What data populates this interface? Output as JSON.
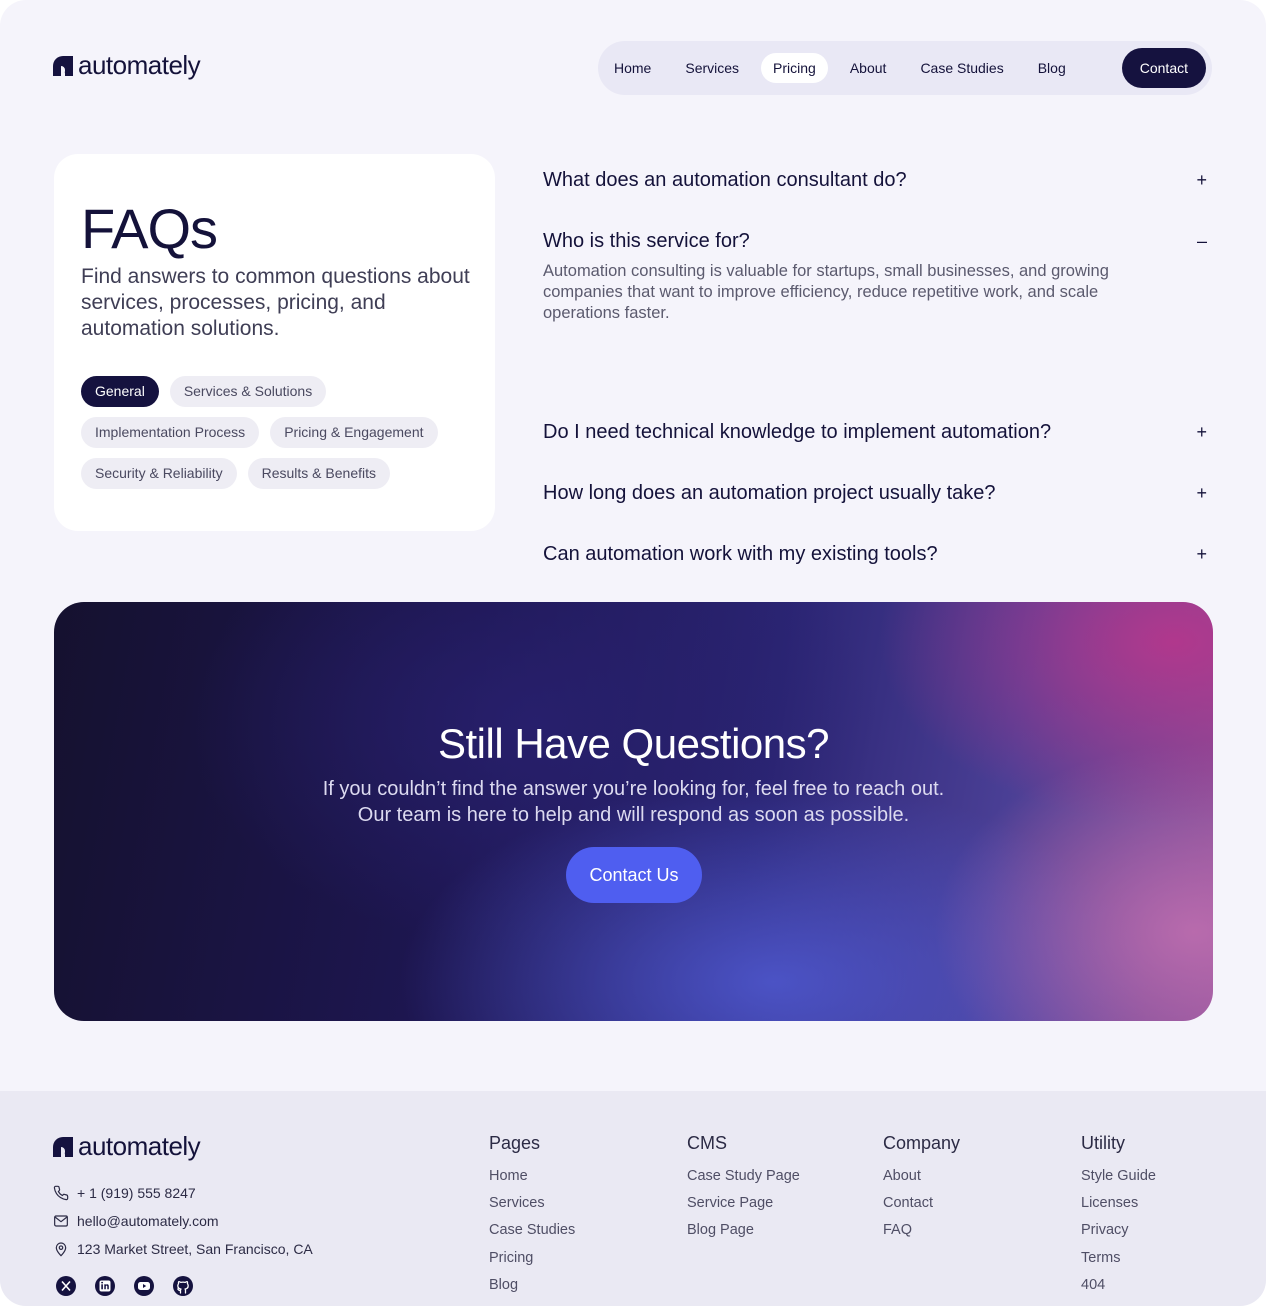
{
  "brand": {
    "name": "automately"
  },
  "nav": {
    "items": [
      "Home",
      "Services",
      "Pricing",
      "About",
      "Case Studies",
      "Blog"
    ],
    "active": "Pricing",
    "cta": "Contact"
  },
  "faq": {
    "title": "FAQs",
    "subtitle": "Find answers to common questions about services, processes, pricing, and automation solutions.",
    "categories": [
      "General",
      "Services & Solutions",
      "Implementation Process",
      "Pricing & Engagement",
      "Security & Reliability",
      "Results & Benefits"
    ],
    "active_category": "General",
    "items": [
      {
        "question": "What does an automation consultant do?",
        "toggle": "+",
        "answer": ""
      },
      {
        "question": "Who is this service for?",
        "toggle": "–",
        "answer": "Automation consulting is valuable for startups, small businesses, and growing companies that want to improve efficiency, reduce repetitive work, and scale operations faster."
      },
      {
        "question": "Do I need technical knowledge to implement automation?",
        "toggle": "+",
        "answer": ""
      },
      {
        "question": "How long does an automation project usually take?",
        "toggle": "+",
        "answer": ""
      },
      {
        "question": "Can automation work with my existing tools?",
        "toggle": "+",
        "answer": ""
      }
    ]
  },
  "cta": {
    "title": "Still Have Questions?",
    "line1": "If you couldn’t find the answer you’re looking for, feel free to reach out.",
    "line2": "Our team is here to help and will respond as soon as possible.",
    "button": "Contact Us"
  },
  "footer": {
    "phone": "+ 1 (919) 555 8247",
    "email": "hello@automately.com",
    "address": "123 Market Street, San Francisco, CA",
    "socials": [
      "x-icon",
      "linkedin-icon",
      "youtube-icon",
      "github-icon"
    ],
    "columns": [
      {
        "title": "Pages",
        "links": [
          "Home",
          "Services",
          "Case Studies",
          "Pricing",
          "Blog"
        ]
      },
      {
        "title": "CMS",
        "links": [
          "Case Study Page",
          "Service Page",
          "Blog Page"
        ]
      },
      {
        "title": "Company",
        "links": [
          "About",
          "Contact",
          "FAQ"
        ]
      },
      {
        "title": "Utility",
        "links": [
          "Style Guide",
          "Licenses",
          "Privacy",
          "Terms",
          "404"
        ]
      }
    ]
  },
  "colors": {
    "primary_dark": "#15123f",
    "accent": "#4f5ef0",
    "background": "#f5f4fb"
  }
}
